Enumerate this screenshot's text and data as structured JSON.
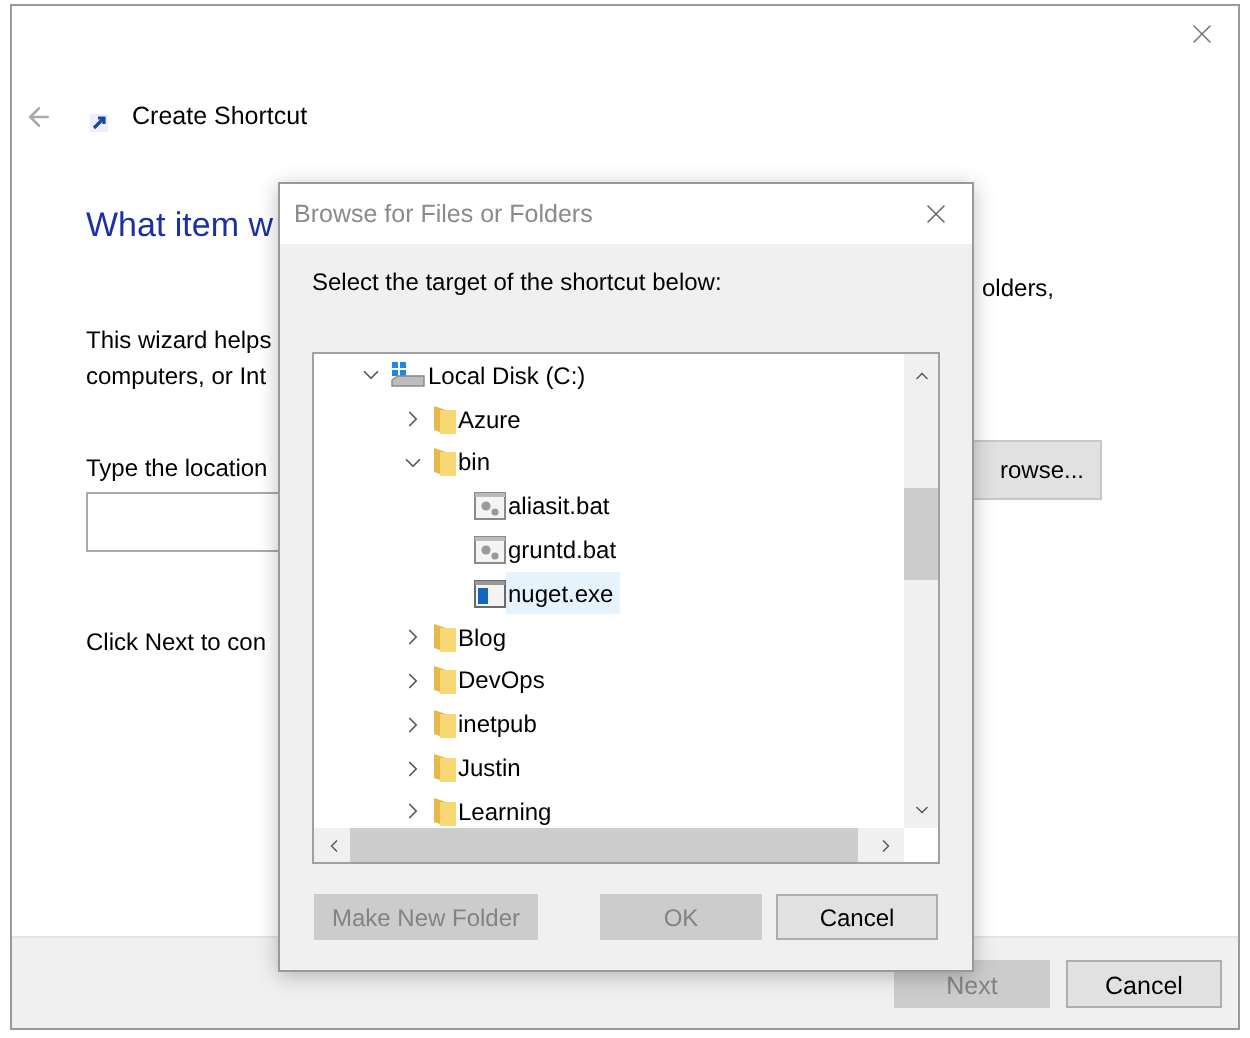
{
  "wizard": {
    "title": "Create Shortcut",
    "heading": "What item w",
    "intro_line_1": "This wizard helps",
    "intro_line_1_end": "olders,",
    "intro_line_2": "computers, or Int",
    "location_label": "Type the location",
    "browse_button": "rowse...",
    "next_hint": "Click Next to con",
    "buttons": [
      {
        "label": "Next",
        "disabled": true
      },
      {
        "label": "Cancel",
        "disabled": false
      }
    ]
  },
  "dialog": {
    "title": "Browse for Files or Folders",
    "prompt": "Select the target of the shortcut below:",
    "tree": [
      {
        "label": "Local Disk (C:)",
        "kind": "drive",
        "expanded": true,
        "selected": false,
        "children": [
          {
            "label": "Azure",
            "kind": "folder",
            "expanded": false,
            "selected": false
          },
          {
            "label": "bin",
            "kind": "folder",
            "expanded": true,
            "selected": false,
            "children": [
              {
                "label": "aliasit.bat",
                "kind": "script",
                "selected": false
              },
              {
                "label": "gruntd.bat",
                "kind": "script",
                "selected": false
              },
              {
                "label": "nuget.exe",
                "kind": "program",
                "selected": true
              }
            ]
          },
          {
            "label": "Blog",
            "kind": "folder",
            "expanded": false,
            "selected": false
          },
          {
            "label": "DevOps",
            "kind": "folder",
            "expanded": false,
            "selected": false
          },
          {
            "label": "inetpub",
            "kind": "folder",
            "expanded": false,
            "selected": false
          },
          {
            "label": "Justin",
            "kind": "folder",
            "expanded": false,
            "selected": false
          },
          {
            "label": "Learning",
            "kind": "folder",
            "expanded": false,
            "selected": false
          }
        ]
      }
    ],
    "buttons": [
      {
        "label": "Make New Folder",
        "disabled": true
      },
      {
        "label": "OK",
        "disabled": true
      },
      {
        "label": "Cancel",
        "disabled": false
      }
    ]
  }
}
